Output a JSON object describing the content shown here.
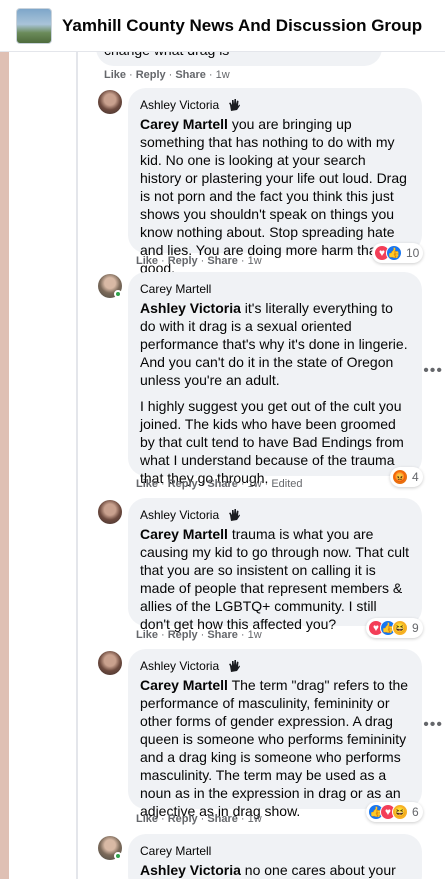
{
  "header": {
    "title": "Yamhill County News And Discussion Group"
  },
  "top_comment": {
    "peek_text": "change what drag is",
    "actions": {
      "like": "Like",
      "reply": "Reply",
      "share": "Share",
      "time": "1w"
    }
  },
  "comments": [
    {
      "author": "Ashley Victoria",
      "mention": "Carey Martell",
      "text": " you are bringing up something that has nothing to do with my kid. No one is looking at your search history or plastering your life out loud. Drag is not porn and the fact you think this just shows you shouldn't speak on things you know nothing about. Stop spreading hate and lies. You are doing more harm than good.",
      "actions": {
        "like": "Like",
        "reply": "Reply",
        "share": "Share",
        "time": "1w"
      },
      "reactions": {
        "types": [
          "love",
          "like"
        ],
        "count": "10"
      }
    },
    {
      "author": "Carey Martell",
      "mention": "Ashley Victoria",
      "text": " it's literally everything to do with it drag is a sexual oriented performance that's why it's done in lingerie. And you can't do it in the state of Oregon unless you're an adult.",
      "text2": "I highly suggest you get out of the cult you joined. The kids who have been groomed by that cult tend to have Bad Endings from what I understand because of the trauma that they go through.",
      "actions": {
        "like": "Like",
        "reply": "Reply",
        "share": "Share",
        "time": "1w",
        "edited": "Edited"
      },
      "reactions": {
        "types": [
          "angry"
        ],
        "count": "4"
      }
    },
    {
      "author": "Ashley Victoria",
      "mention": "Carey Martell",
      "text": " trauma is what you are causing my kid to go through now. That cult that you are so insistent on calling it is made of people that represent members & allies of the LGBTQ+ community. I still don't get how this affected you?",
      "actions": {
        "like": "Like",
        "reply": "Reply",
        "share": "Share",
        "time": "1w"
      },
      "reactions": {
        "types": [
          "love",
          "like",
          "haha"
        ],
        "count": "9"
      }
    },
    {
      "author": "Ashley Victoria",
      "mention": "Carey Martell",
      "text": " The term \"drag\" refers to the performance of masculinity, femininity or other forms of gender expression. A drag queen is someone who performs femininity and a drag king is someone who performs masculinity. The term may be used as a noun as in the expression in drag or as an adjective as in drag show.",
      "actions": {
        "like": "Like",
        "reply": "Reply",
        "share": "Share",
        "time": "1w"
      },
      "reactions": {
        "types": [
          "like",
          "love",
          "haha"
        ],
        "count": "6"
      }
    },
    {
      "author": "Carey Martell",
      "mention": "Ashley Victoria",
      "text": " no one cares about your word play. The only thing anybody cares"
    }
  ],
  "colors": {
    "bubble": "#f0f2f5",
    "meta_text": "#65676b",
    "like_blue": "#1877f2",
    "love_red": "#f33e58",
    "online_green": "#31a24c"
  },
  "icons": {
    "badge": "top-fan-hand-icon",
    "more": "more-horizontal-icon"
  }
}
